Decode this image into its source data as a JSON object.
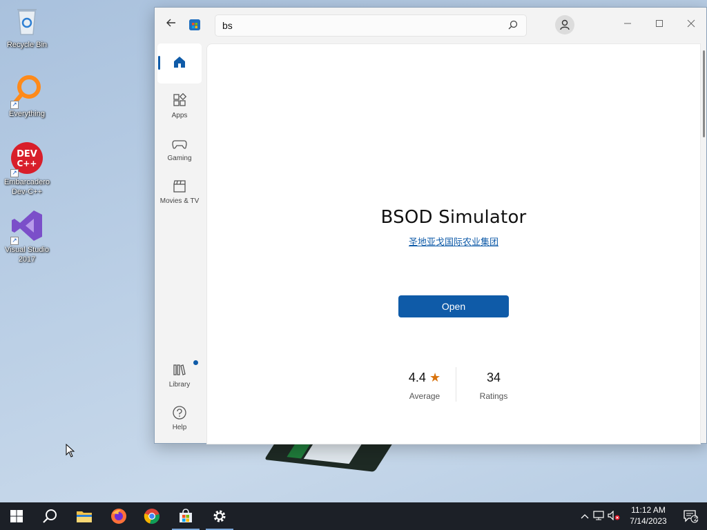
{
  "desktop": {
    "icons": [
      {
        "label": "Recycle Bin"
      },
      {
        "label": "Everything"
      },
      {
        "label": "Embarcadero Dev-C++"
      },
      {
        "label": "Visual Studio 2017"
      }
    ]
  },
  "store": {
    "search": {
      "value": "bs"
    },
    "nav": {
      "apps": "Apps",
      "gaming": "Gaming",
      "movies": "Movies & TV",
      "library": "Library",
      "help": "Help"
    },
    "app": {
      "title": "BSOD Simulator",
      "publisher": "圣地亚戈国际农业集团",
      "open_label": "Open",
      "rating_value": "4.4",
      "rating_label": "Average",
      "ratings_count": "34",
      "ratings_label": "Ratings"
    }
  },
  "taskbar": {
    "time": "11:12 AM",
    "date": "7/14/2023",
    "notification_count": "2"
  },
  "colors": {
    "accent": "#0f5ba8",
    "star": "#d9730d",
    "taskbar": "#1c2027"
  }
}
